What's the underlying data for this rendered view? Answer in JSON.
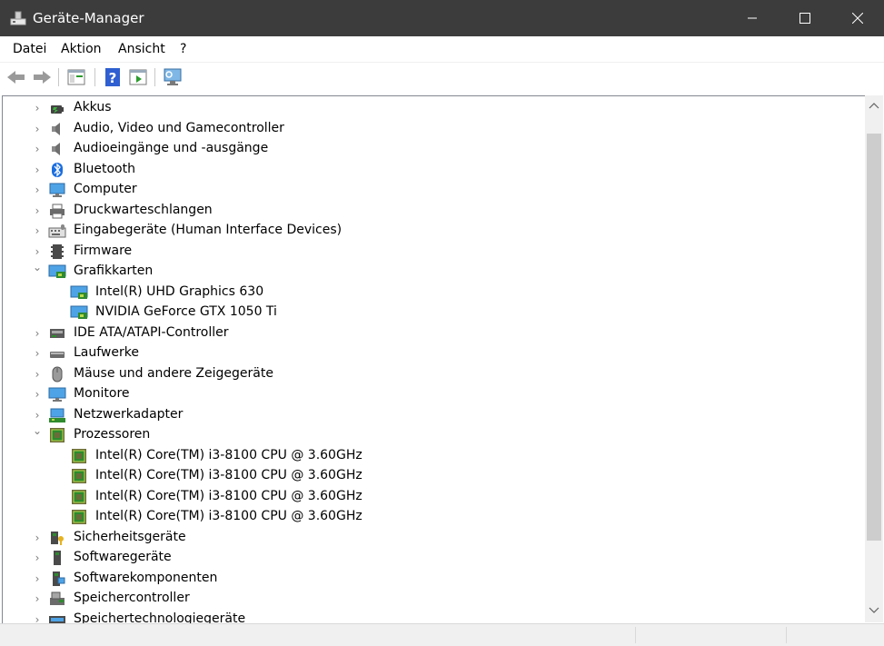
{
  "window": {
    "title": "Geräte-Manager"
  },
  "menu": [
    "Datei",
    "Aktion",
    "Ansicht",
    "?"
  ],
  "toolbar": [
    "back-icon",
    "forward-icon",
    "properties-pane-icon",
    "help-icon",
    "run-icon",
    "scan-hardware-icon"
  ],
  "tree": {
    "items": [
      {
        "label": "Akkus",
        "expanded": false,
        "icon": "battery-icon"
      },
      {
        "label": "Audio, Video und Gamecontroller",
        "expanded": false,
        "icon": "speaker-icon"
      },
      {
        "label": "Audioeingänge und -ausgänge",
        "expanded": false,
        "icon": "speaker-icon"
      },
      {
        "label": "Bluetooth",
        "expanded": false,
        "icon": "bluetooth-icon"
      },
      {
        "label": "Computer",
        "expanded": false,
        "icon": "computer-icon"
      },
      {
        "label": "Druckwarteschlangen",
        "expanded": false,
        "icon": "printer-icon"
      },
      {
        "label": "Eingabegeräte (Human Interface Devices)",
        "expanded": false,
        "icon": "hid-icon"
      },
      {
        "label": "Firmware",
        "expanded": false,
        "icon": "firmware-icon"
      },
      {
        "label": "Grafikkarten",
        "expanded": true,
        "icon": "display-adapter-icon",
        "children": [
          {
            "label": "Intel(R) UHD Graphics 630",
            "icon": "display-adapter-icon"
          },
          {
            "label": "NVIDIA GeForce GTX 1050 Ti",
            "icon": "display-adapter-icon"
          }
        ]
      },
      {
        "label": "IDE ATA/ATAPI-Controller",
        "expanded": false,
        "icon": "ide-controller-icon"
      },
      {
        "label": "Laufwerke",
        "expanded": false,
        "icon": "drive-icon"
      },
      {
        "label": "Mäuse und andere Zeigegeräte",
        "expanded": false,
        "icon": "mouse-icon"
      },
      {
        "label": "Monitore",
        "expanded": false,
        "icon": "monitor-icon"
      },
      {
        "label": "Netzwerkadapter",
        "expanded": false,
        "icon": "network-adapter-icon"
      },
      {
        "label": "Prozessoren",
        "expanded": true,
        "icon": "processor-icon",
        "children": [
          {
            "label": "Intel(R) Core(TM) i3-8100 CPU @ 3.60GHz",
            "icon": "processor-icon"
          },
          {
            "label": "Intel(R) Core(TM) i3-8100 CPU @ 3.60GHz",
            "icon": "processor-icon"
          },
          {
            "label": "Intel(R) Core(TM) i3-8100 CPU @ 3.60GHz",
            "icon": "processor-icon"
          },
          {
            "label": "Intel(R) Core(TM) i3-8100 CPU @ 3.60GHz",
            "icon": "processor-icon"
          }
        ]
      },
      {
        "label": "Sicherheitsgeräte",
        "expanded": false,
        "icon": "security-device-icon"
      },
      {
        "label": "Softwaregeräte",
        "expanded": false,
        "icon": "software-device-icon"
      },
      {
        "label": "Softwarekomponenten",
        "expanded": false,
        "icon": "software-component-icon"
      },
      {
        "label": "Speichercontroller",
        "expanded": false,
        "icon": "storage-controller-icon"
      },
      {
        "label": "Speichertechnologiegeräte",
        "expanded": false,
        "icon": "memory-technology-icon"
      }
    ]
  }
}
